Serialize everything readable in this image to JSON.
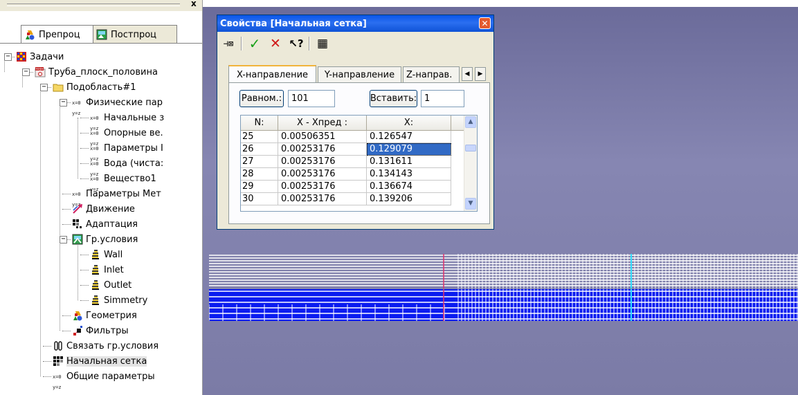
{
  "left_panel": {
    "close_glyph": "x",
    "tabs": [
      {
        "label": "Препроц",
        "icon": "shapes-icon"
      },
      {
        "label": "Постпроц",
        "icon": "image-icon"
      }
    ]
  },
  "tree": [
    {
      "label": "Задачи",
      "icon": "grid-icon",
      "expander": "−"
    },
    {
      "label": "Труба_плоск_половина",
      "icon": "flash-project-icon",
      "expander": "−"
    },
    {
      "label": "Подобласть#1",
      "icon": "folder-icon",
      "expander": "−"
    },
    {
      "label": "Физические пар",
      "icon": "xy-params-icon",
      "expander": "−"
    },
    {
      "label": "Начальные з",
      "icon": "xy-params-icon"
    },
    {
      "label": "Опорные ве.",
      "icon": "xy-params-icon"
    },
    {
      "label": "Параметры I",
      "icon": "xy-params-icon"
    },
    {
      "label": "Вода (чиста:",
      "icon": "xy-params-icon"
    },
    {
      "label": "Вещество1",
      "icon": "xy-params-icon"
    },
    {
      "label": "Параметры Мет",
      "icon": "xy-params-icon"
    },
    {
      "label": "Движение",
      "icon": "motion-icon"
    },
    {
      "label": "Адаптация",
      "icon": "adaptation-grid-icon"
    },
    {
      "label": "Гр.условия",
      "icon": "boundary-conditions-icon",
      "expander": "−"
    },
    {
      "label": "Wall",
      "icon": "boundary-marker-icon"
    },
    {
      "label": "Inlet",
      "icon": "boundary-marker-icon"
    },
    {
      "label": "Outlet",
      "icon": "boundary-marker-icon"
    },
    {
      "label": "Simmetry",
      "icon": "boundary-marker-icon"
    },
    {
      "label": "Геометрия",
      "icon": "shapes-icon"
    },
    {
      "label": "Фильтры",
      "icon": "filter-icon"
    },
    {
      "label": "Связать гр.условия",
      "icon": "link-icon"
    },
    {
      "label": "Начальная сетка",
      "icon": "grid-dots-icon"
    },
    {
      "label": "Общие параметры",
      "icon": "xy-params-icon"
    }
  ],
  "dialog": {
    "title": "Свойства [Начальная сетка]",
    "close_glyph": "✕",
    "toolbar": [
      {
        "name": "pin-icon",
        "glyph": "⊣⊠"
      },
      {
        "name": "apply-check-icon",
        "glyph": "✓"
      },
      {
        "name": "cancel-x-icon",
        "glyph": "✕"
      },
      {
        "name": "help-pointer-icon",
        "glyph": "↖?"
      },
      {
        "name": "grid-dots-icon",
        "glyph": "▦"
      }
    ],
    "tabs": [
      "X-направление",
      "Y-направление",
      "Z-направ."
    ],
    "tab_arrows": [
      "◀",
      "▶"
    ],
    "uniform_label": "Равном.:",
    "uniform_value": "101",
    "insert_label": "Вставить:",
    "insert_value": "1",
    "grid": {
      "columns": [
        "N:",
        "X - Xпред :",
        "X:"
      ],
      "rows": [
        [
          "25",
          "0.00506351",
          "0.126547"
        ],
        [
          "26",
          "0.00253176",
          "0.129079"
        ],
        [
          "27",
          "0.00253176",
          "0.131611"
        ],
        [
          "28",
          "0.00253176",
          "0.134143"
        ],
        [
          "29",
          "0.00253176",
          "0.136674"
        ],
        [
          "30",
          "0.00253176",
          "0.139206"
        ]
      ],
      "selected_row": 1,
      "scroll_up": "▲",
      "scroll_down": "▼"
    }
  },
  "colors": {
    "mesh_blue": "#0a1cf0",
    "mesh_line_red": "#e0306a",
    "mesh_line_cyan": "#30e0ff",
    "viewport": "#7b7ba6"
  }
}
